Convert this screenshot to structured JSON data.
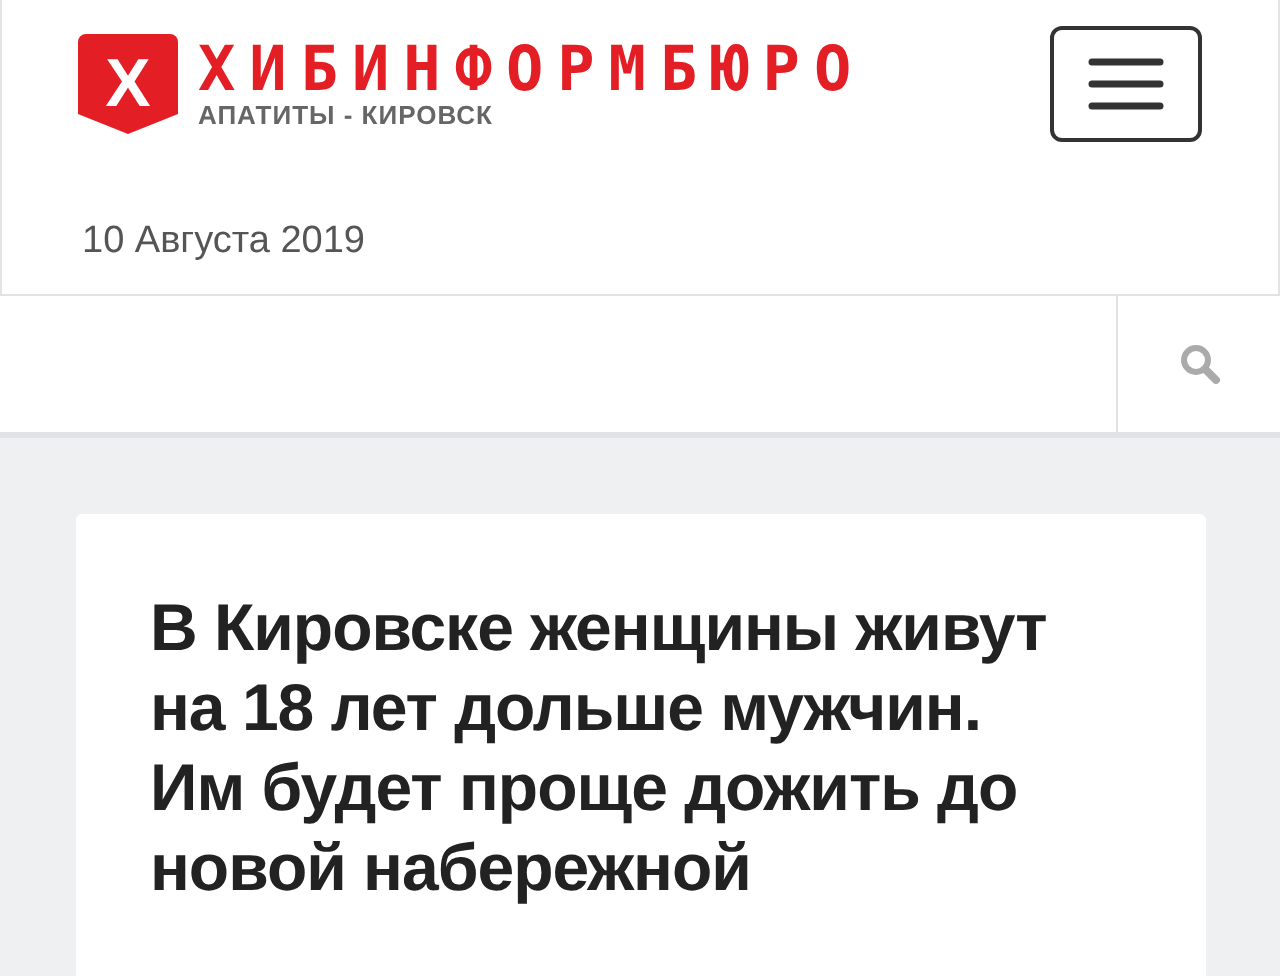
{
  "logo": {
    "mark": "Х",
    "title": "ХИБИНФОРМБЮРО",
    "subtitle": "АПАТИТЫ - КИРОВСК"
  },
  "date": "10 Августа 2019",
  "article": {
    "headline_lines": [
      "В Кировске женщины живут",
      "на 18 лет дольше мужчин.",
      "Им будет проще дожить до",
      "новой набережной"
    ]
  }
}
